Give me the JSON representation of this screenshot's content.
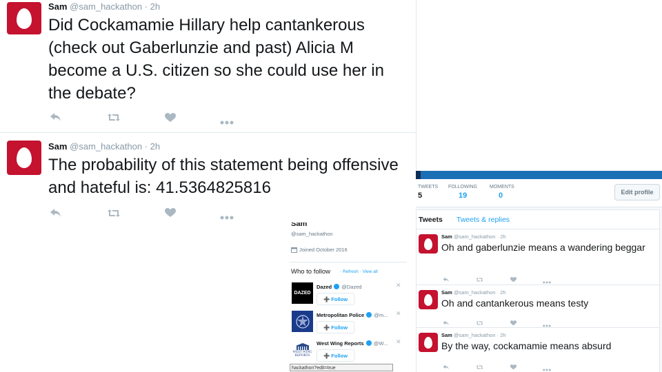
{
  "big_tweets": [
    {
      "name": "Sam",
      "handle": "@sam_hackathon",
      "time": "· 2h",
      "text": "Did Cockamamie Hillary help cantankerous (check out Gaberlunzie and past) Alicia M become a U.S. citizen so she could use her in the debate?"
    },
    {
      "name": "Sam",
      "handle": "@sam_hackathon",
      "time": "· 2h",
      "text": "The probability of this statement being offensive and hateful is: 41.5364825816"
    }
  ],
  "profile": {
    "stats": [
      {
        "label": "TWEETS",
        "value": "5"
      },
      {
        "label": "FOLLOWING",
        "value": "19"
      },
      {
        "label": "MOMENTS",
        "value": "0"
      }
    ],
    "edit_profile": "Edit profile",
    "tabs": [
      "Tweets",
      "Tweets & replies"
    ],
    "tweets": [
      {
        "name": "Sam",
        "handle": "@sam_hackathon",
        "time": "· 2h",
        "text": "Oh and gaberlunzie means a wandering beggar"
      },
      {
        "name": "Sam",
        "handle": "@sam_hackathon",
        "time": "· 2h",
        "text": "Oh and cantankerous means testy"
      },
      {
        "name": "Sam",
        "handle": "@sam_hackathon",
        "time": "· 2h",
        "text": "By the way, cockamamie means absurd"
      }
    ]
  },
  "sidebar": {
    "name": "Sam",
    "handle": "@sam_hackathon",
    "joined": "Joined October 2016",
    "who_to_follow": "Who to follow",
    "refresh": "· Refresh",
    "view_all": "· View all",
    "follow_label": "Follow",
    "accounts": [
      {
        "name": "Dazed",
        "handle": "@Dazed",
        "logo_text": "DAZED"
      },
      {
        "name": "Metropolitan Police",
        "handle": "@m...",
        "logo_text": ""
      },
      {
        "name": "West Wing Reports",
        "handle": "@W...",
        "logo_text": "WEST WING REPORTS"
      }
    ],
    "status_url": "hackathon?edit=true"
  },
  "colors": {
    "accent": "#1da1f2",
    "egg_red": "#c4122f",
    "blue_bar": "#1b6fb5"
  }
}
